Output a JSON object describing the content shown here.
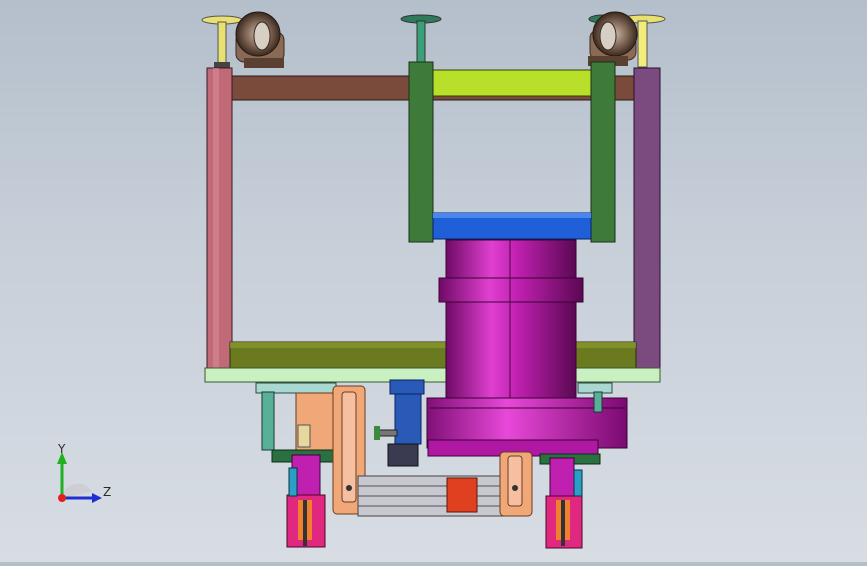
{
  "viewport": {
    "background_top": "#b4bfcb",
    "background_bottom": "#d8dde4"
  },
  "model_colors": {
    "frame_left_post": "#c06a78",
    "frame_top_beam": "#7a4a3a",
    "frame_right_post": "#7b4a7f",
    "frame_bottom_beam": "#6b7a1e",
    "base_plate": "#c8f0c0",
    "bracket_green": "#3e7a38",
    "bracket_top": "#b8e02a",
    "blue_plate": "#1f5fd8",
    "cylinder_magenta": "#c020b0",
    "caster_wheel": "#6a5040",
    "post_yellow": "#e8e070",
    "slider_orange": "#f0a878",
    "actuator_pink": "#e02880",
    "servo_blue": "#2a5ab8",
    "block_red": "#e04020"
  },
  "triad": {
    "y_label": "Y",
    "z_label": "Z",
    "icon": "coordinate-triad-icon"
  }
}
